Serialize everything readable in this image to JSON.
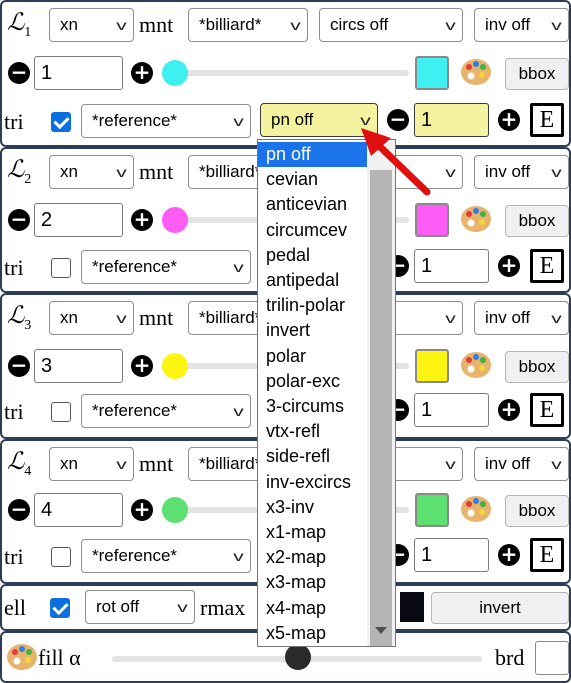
{
  "colors": {
    "row1": "#3ff0f0",
    "row2": "#ff5cf5",
    "row3": "#fbf510",
    "row4": "#5ce070",
    "accent": "#1a73e8",
    "arrow": "#e01010",
    "highlight": "#f6f3a0"
  },
  "rows": [
    {
      "label": "ℒ",
      "sub": "1",
      "n_sel": "xn",
      "mnt_label": "mnt",
      "mnt_sel": "*billiard*",
      "circs_sel": "circs off",
      "inv_sel": "inv off",
      "num": "1",
      "bbox_label": "bbox",
      "tri_label": "tri",
      "tri_checked": true,
      "tri_sel": "*reference*",
      "pn_sel": "pn off",
      "pn_num": "1",
      "e_label": "E",
      "thumb_pos": 0.0
    },
    {
      "label": "ℒ",
      "sub": "2",
      "n_sel": "xn",
      "mnt_label": "mnt",
      "mnt_sel": "*billiard*",
      "inv_sel": "inv off",
      "num": "2",
      "bbox_label": "bbox",
      "tri_label": "tri",
      "tri_checked": false,
      "tri_sel": "*reference*",
      "pn_num": "1",
      "e_label": "E",
      "thumb_pos": 0.0
    },
    {
      "label": "ℒ",
      "sub": "3",
      "n_sel": "xn",
      "mnt_label": "mnt",
      "mnt_sel": "*billiard*",
      "inv_sel": "inv off",
      "num": "3",
      "bbox_label": "bbox",
      "tri_label": "tri",
      "tri_checked": false,
      "tri_sel": "*reference*",
      "pn_num": "1",
      "e_label": "E",
      "thumb_pos": 0.0
    },
    {
      "label": "ℒ",
      "sub": "4",
      "n_sel": "xn",
      "mnt_label": "mnt",
      "mnt_sel": "*billiard*",
      "inv_sel": "inv off",
      "num": "4",
      "bbox_label": "bbox",
      "tri_label": "tri",
      "tri_checked": false,
      "tri_sel": "*reference*",
      "pn_num": "1",
      "e_label": "E",
      "thumb_pos": 0.0
    }
  ],
  "ell": {
    "label": "ell",
    "checked": true,
    "rot_sel": "rot off",
    "rmax_label": "rmax",
    "invert_label": "invert"
  },
  "fill": {
    "label": "fill α",
    "brd_label": "brd",
    "alpha": 0.5
  },
  "dropdown": {
    "options": [
      "pn off",
      "cevian",
      "anticevian",
      "circumcev",
      "pedal",
      "antipedal",
      "trilin-polar",
      "invert",
      "polar",
      "polar-exc",
      "3-circums",
      "vtx-refl",
      "side-refl",
      "inv-excircs",
      "x3-inv",
      "x1-map",
      "x2-map",
      "x3-map",
      "x4-map",
      "x5-map"
    ],
    "selected_index": 0
  },
  "icons": {
    "minus": "minus-circle-icon",
    "plus": "plus-circle-icon",
    "palette": "palette-icon",
    "check": "checkmark-icon",
    "chevron": "chevron-down-icon",
    "arrow": "red-arrow-icon"
  }
}
